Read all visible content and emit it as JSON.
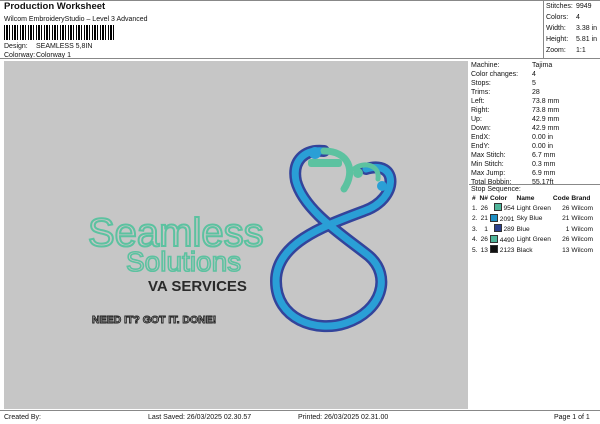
{
  "header": {
    "title": "Production Worksheet",
    "software": "Wilcom EmbroideryStudio – Level 3 Advanced",
    "design_label": "Design:",
    "design_value": "SEAMLESS 5,8IN",
    "colorway_label": "Colorway:",
    "colorway_value": "Colorway 1"
  },
  "summary": [
    {
      "label": "Stitches:",
      "value": "9949"
    },
    {
      "label": "Colors:",
      "value": "4"
    },
    {
      "label": "Width:",
      "value": "3.38 in"
    },
    {
      "label": "Height:",
      "value": "5.81 in"
    },
    {
      "label": "Zoom:",
      "value": "1:1"
    }
  ],
  "machine_info": [
    {
      "label": "Machine:",
      "value": "Tajima"
    },
    {
      "label": "Color changes:",
      "value": "4"
    },
    {
      "label": "Stops:",
      "value": "5"
    },
    {
      "label": "Trims:",
      "value": "28"
    },
    {
      "label": "Left:",
      "value": "73.8 mm"
    },
    {
      "label": "Right:",
      "value": "73.8 mm"
    },
    {
      "label": "Up:",
      "value": "42.9 mm"
    },
    {
      "label": "Down:",
      "value": "42.9 mm"
    },
    {
      "label": "EndX:",
      "value": "0.00 in"
    },
    {
      "label": "EndY:",
      "value": "0.00 in"
    },
    {
      "label": "Max Stitch:",
      "value": "6.7 mm"
    },
    {
      "label": "Min Stitch:",
      "value": "0.3 mm"
    },
    {
      "label": "Max Jump:",
      "value": "6.9 mm"
    },
    {
      "label": "Total Bobbin:",
      "value": "55.17ft"
    }
  ],
  "stop_sequence": {
    "title": "Stop Sequence:",
    "headers": [
      "#",
      "N#",
      "Color",
      "Name",
      "Code",
      "Brand"
    ],
    "rows": [
      {
        "num": "1.",
        "n": "26",
        "color": "954",
        "name": "Light Green",
        "code": "26",
        "brand": "Wilcom",
        "hex": "#4fb59a"
      },
      {
        "num": "2.",
        "n": "21",
        "color": "2091",
        "name": "Sky Blue",
        "code": "21",
        "brand": "Wilcom",
        "hex": "#1f8fc4"
      },
      {
        "num": "3.",
        "n": "1",
        "color": "289",
        "name": "Blue",
        "code": "1",
        "brand": "Wilcom",
        "hex": "#2b3f8c"
      },
      {
        "num": "4.",
        "n": "26",
        "color": "4490",
        "name": "Light Green",
        "code": "26",
        "brand": "Wilcom",
        "hex": "#4fb59a"
      },
      {
        "num": "5.",
        "n": "13",
        "color": "2123",
        "name": "Black",
        "code": "13",
        "brand": "Wilcom",
        "hex": "#111111"
      }
    ]
  },
  "design": {
    "word1": "Seamless",
    "word2": "Solutions",
    "word3": "VA SERVICES",
    "tagline": "NEED IT? GOT IT. DONE!",
    "colors": {
      "green": "#5cc2a0",
      "sky": "#2a9fd6",
      "blue": "#33449b",
      "dark": "#222222"
    }
  },
  "footer": {
    "created": "Created By:",
    "saved": "Last Saved: 26/03/2025 02.30.57",
    "printed": "Printed: 26/03/2025 02.31.00",
    "page": "Page 1 of 1"
  }
}
